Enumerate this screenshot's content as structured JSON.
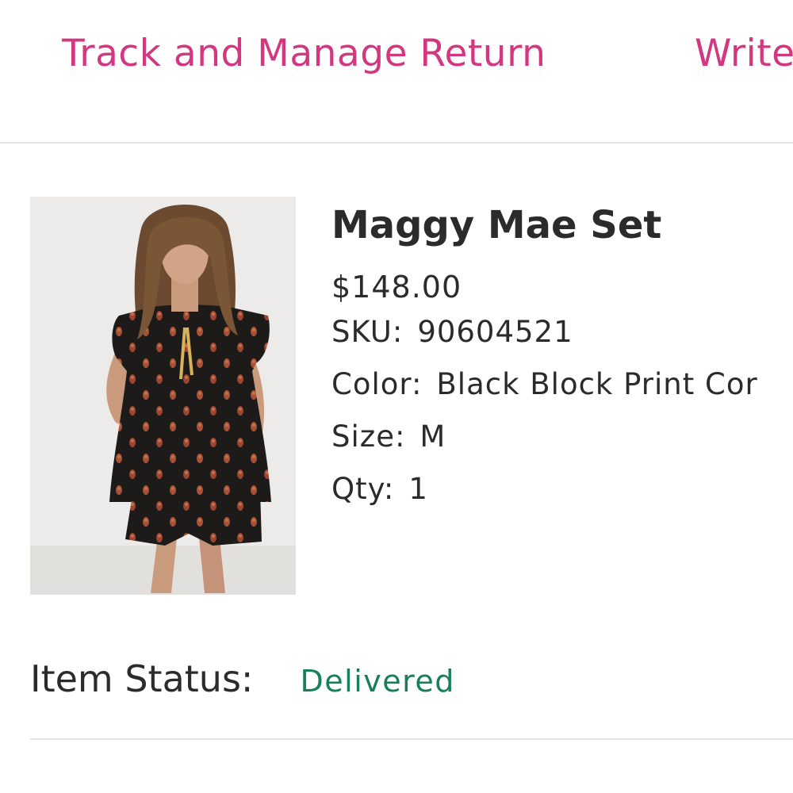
{
  "actions": {
    "track_return": "Track and Manage Return",
    "write_review": "Write"
  },
  "product": {
    "name": "Maggy Mae Set",
    "price": "$148.00",
    "sku_label": "SKU:",
    "sku": "90604521",
    "color_label": "Color:",
    "color": "Black Block Print Cor",
    "size_label": "Size:",
    "size": "M",
    "qty_label": "Qty:",
    "qty": "1",
    "image_icon": "product-photo"
  },
  "status": {
    "label": "Item Status:",
    "value": "Delivered"
  },
  "colors": {
    "accent": "#d2377f",
    "status_delivered": "#177f5c",
    "text": "#2b2b2b",
    "divider": "#e6e6e6"
  }
}
